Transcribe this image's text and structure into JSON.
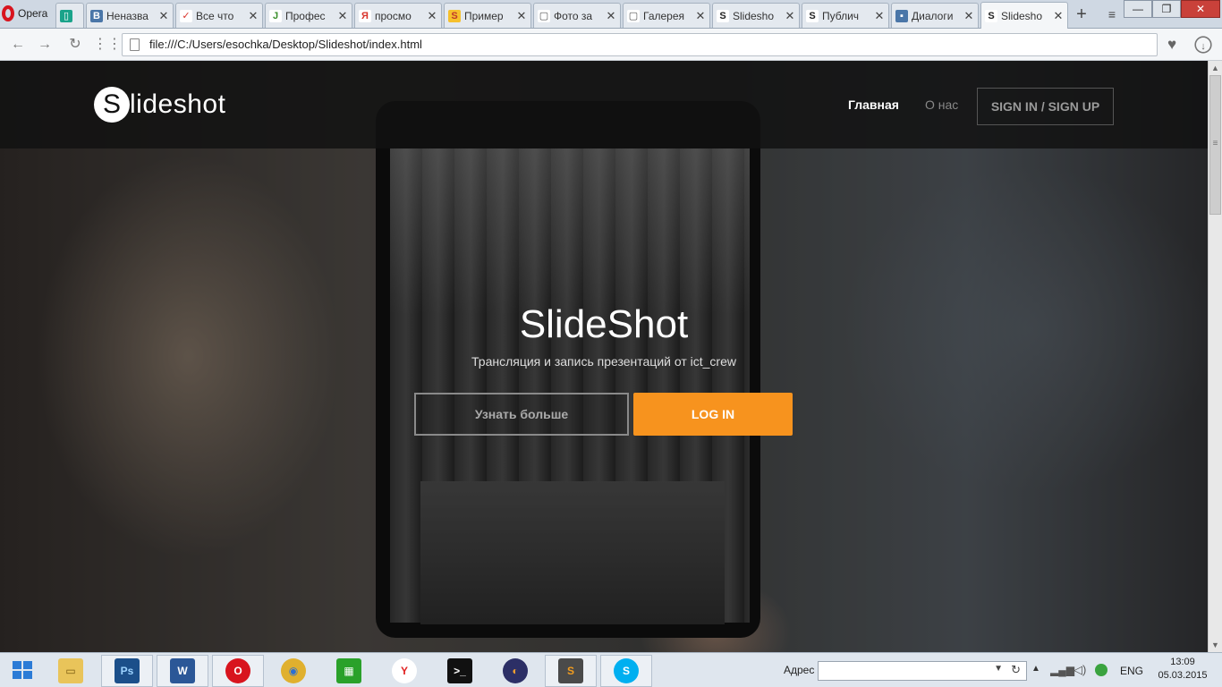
{
  "browser": {
    "opera_label": "Opera",
    "tabs": [
      {
        "title": "",
        "fav_bg": "#1aa38a",
        "fav_glyph": "▯"
      },
      {
        "title": "Неназва",
        "fav_bg": "#4a76a8",
        "fav_glyph": "B"
      },
      {
        "title": "Все что",
        "fav_bg": "#d9332b",
        "fav_glyph": "✓"
      },
      {
        "title": "Профес",
        "fav_bg": "#3a8f2a",
        "fav_glyph": "J"
      },
      {
        "title": "просмо",
        "fav_bg": "#e8e8e8",
        "fav_glyph": "Я"
      },
      {
        "title": "Пример",
        "fav_bg": "#f6c02c",
        "fav_glyph": "S"
      },
      {
        "title": "Фото за",
        "fav_bg": "#c7ccd2",
        "fav_glyph": "▢"
      },
      {
        "title": "Галерея",
        "fav_bg": "#c7ccd2",
        "fav_glyph": "▢"
      },
      {
        "title": "Slidesho",
        "fav_bg": "#f4f6f8",
        "fav_glyph": "S"
      },
      {
        "title": "Публич",
        "fav_bg": "#f4f6f8",
        "fav_glyph": "S"
      },
      {
        "title": "Диалоги",
        "fav_bg": "#4a76a8",
        "fav_glyph": "▪"
      },
      {
        "title": "Slidesho",
        "fav_bg": "#f4f6f8",
        "fav_glyph": "S"
      }
    ],
    "new_tab": "+",
    "tab_menu": "≡",
    "url": "file:///C:/Users/esochka/Desktop/Slideshot/index.html",
    "window_controls": {
      "minimize": "—",
      "maximize": "❐",
      "close": "✕"
    }
  },
  "site": {
    "brand_letter": "S",
    "brand_text": "lideshot",
    "nav": {
      "home": "Главная",
      "about": "О нас",
      "sign": "SIGN IN / SIGN UP"
    },
    "hero": {
      "title": "SlideShot",
      "subtitle": "Трансляция и запись презентаций от ict_crew",
      "more_button": "Узнать больше",
      "login_button": "LOG IN"
    },
    "accent_color": "#f7931e"
  },
  "taskbar": {
    "apps": [
      {
        "name": "explorer",
        "glyph": "▭",
        "bg": "#e9c45a"
      },
      {
        "name": "photoshop",
        "glyph": "Ps",
        "bg": "#1b4f8a"
      },
      {
        "name": "word",
        "glyph": "W",
        "bg": "#2b5797"
      },
      {
        "name": "opera",
        "glyph": "O",
        "bg": "#d8141e"
      },
      {
        "name": "chrome",
        "glyph": "◉",
        "bg": "#e0b02e"
      },
      {
        "name": "store",
        "glyph": "▦",
        "bg": "#2aa12a"
      },
      {
        "name": "yandex",
        "glyph": "Y",
        "bg": "#e02020"
      },
      {
        "name": "cmd",
        "glyph": ">_",
        "bg": "#111111"
      },
      {
        "name": "eclipse",
        "glyph": "◐",
        "bg": "#2c2f66"
      },
      {
        "name": "sublime",
        "glyph": "S",
        "bg": "#4a4a4a"
      },
      {
        "name": "skype",
        "glyph": "S",
        "bg": "#00aff0"
      }
    ],
    "address_label": "Адрес",
    "address_value": "",
    "language": "ENG",
    "time": "13:09",
    "date": "05.03.2015"
  }
}
